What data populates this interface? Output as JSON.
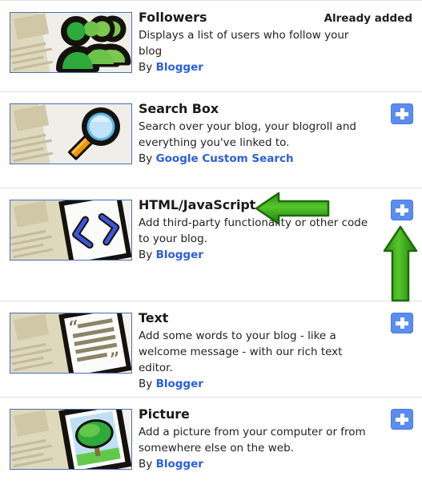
{
  "page": {
    "kind": "gadget-picker-list",
    "accent_blue": "#5b8def",
    "link_blue": "#2b5fd9",
    "annotation_green": "#3ea518",
    "separator": "#e2e2e2",
    "thumb_border": "#4a6fb5"
  },
  "gadgets": [
    {
      "title": "Followers",
      "desc": "Displays a list of users who follow your blog",
      "by_prefix": "By",
      "author": "Blogger",
      "status": "Already added",
      "has_add_button": false,
      "icon": "followers-people-icon"
    },
    {
      "title": "Search Box",
      "desc": "Search over your blog, your blogroll and everything you've linked to.",
      "by_prefix": "By",
      "author": "Google Custom Search",
      "status": "",
      "has_add_button": true,
      "icon": "magnifier-icon"
    },
    {
      "title": "HTML/JavaScript",
      "desc": "Add third-party functionality or other code to your blog.",
      "by_prefix": "By",
      "author": "Blogger",
      "status": "",
      "has_add_button": true,
      "icon": "code-brackets-icon"
    },
    {
      "title": "Text",
      "desc": "Add some words to your blog - like a welcome message - with our rich text editor.",
      "by_prefix": "By",
      "author": "Blogger",
      "status": "",
      "has_add_button": true,
      "icon": "quoted-text-icon"
    },
    {
      "title": "Picture",
      "desc": "Add a picture from your computer or from somewhere else on the web.",
      "by_prefix": "By",
      "author": "Blogger",
      "status": "",
      "has_add_button": true,
      "icon": "picture-tree-icon"
    }
  ],
  "annotations": [
    {
      "name": "arrow-left-annotation",
      "direction": "left",
      "color": "#3ea518",
      "points_at": "HTML/JavaScript"
    },
    {
      "name": "arrow-up-annotation",
      "direction": "up",
      "color": "#3ea518",
      "points_at": "HTML/JavaScript add button"
    }
  ],
  "add_button_label": "+"
}
